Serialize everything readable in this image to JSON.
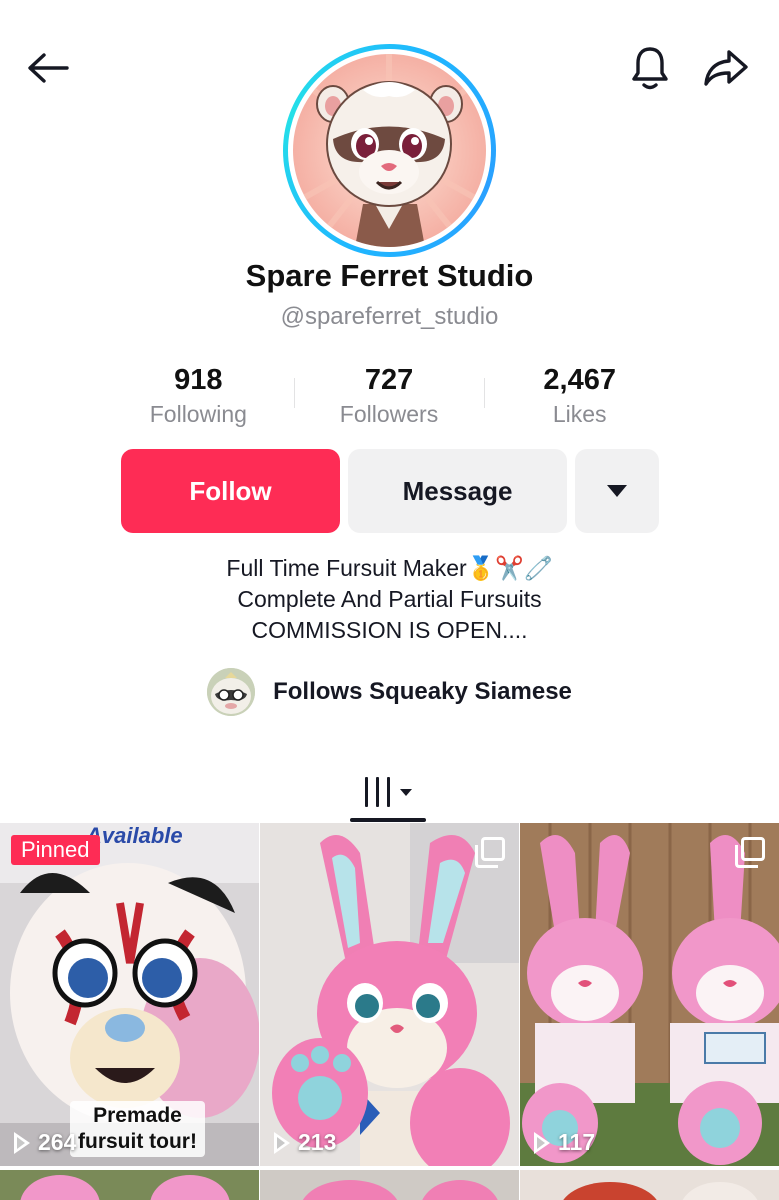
{
  "header": {
    "back_icon": "arrow-left-icon",
    "notification_icon": "bell-icon",
    "share_icon": "share-arrow-icon"
  },
  "profile": {
    "name": "Spare Ferret Studio",
    "handle": "@spareferret_studio",
    "avatar_ring_color": "#25c4f0"
  },
  "stats": [
    {
      "value": "918",
      "label": "Following"
    },
    {
      "value": "727",
      "label": "Followers"
    },
    {
      "value": "2,467",
      "label": "Likes"
    }
  ],
  "actions": {
    "follow_label": "Follow",
    "message_label": "Message",
    "more_icon": "caret-down-icon",
    "follow_color": "#fe2c55"
  },
  "bio": {
    "line1": "Full Time Fursuit Maker🥇✂️🧷",
    "line2": "Complete And Partial Fursuits",
    "line3": "COMMISSION IS OPEN...."
  },
  "mutual": {
    "text": "Follows Squeaky Siamese"
  },
  "tabs": {
    "active": "videos-grid",
    "icon": "grid-icon"
  },
  "videos": [
    {
      "views": "264",
      "pinned_label": "Pinned",
      "caption_line1": "Premade",
      "caption_line2": "fursuit tour!",
      "overlay_text": "Available"
    },
    {
      "views": "213",
      "multi_icon": "multi-photo-icon"
    },
    {
      "views": "117",
      "multi_icon": "multi-photo-icon"
    }
  ]
}
